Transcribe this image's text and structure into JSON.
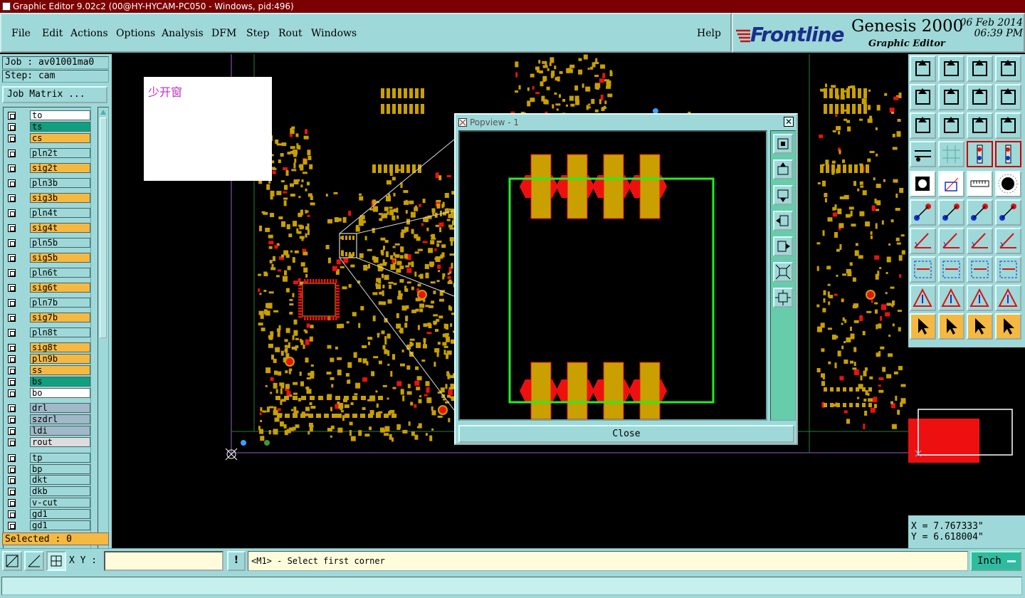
{
  "window": {
    "title": "Graphic Editor 9.02c2 (00@HY-HYCAM-PC050 - Windows, pid:496)"
  },
  "menu": {
    "items": [
      "File",
      "Edit",
      "Actions",
      "Options",
      "Analysis",
      "DFM",
      "Step",
      "Rout",
      "Windows"
    ],
    "help": "Help"
  },
  "brand": {
    "logo": "Frontline",
    "product": "Genesis 2000",
    "subtitle": "Graphic Editor",
    "date": "06 Feb 2014",
    "time": "06:39 PM"
  },
  "job": {
    "job_label": "Job : av01001ma0",
    "step_label": "Step: cam",
    "matrix_button": "Job Matrix ..."
  },
  "layers": [
    {
      "name": "to",
      "color": "#ffffff"
    },
    {
      "name": "ts",
      "color": "#10a080"
    },
    {
      "name": "cs",
      "color": "#f5b942"
    },
    {
      "name": "pln2t",
      "color": "#9fd8d8"
    },
    {
      "name": "sig2t",
      "color": "#f5b942"
    },
    {
      "name": "pln3b",
      "color": "#9fd8d8"
    },
    {
      "name": "sig3b",
      "color": "#f5b942"
    },
    {
      "name": "pln4t",
      "color": "#9fd8d8"
    },
    {
      "name": "sig4t",
      "color": "#f5b942"
    },
    {
      "name": "pln5b",
      "color": "#9fd8d8"
    },
    {
      "name": "sig5b",
      "color": "#f5b942"
    },
    {
      "name": "pln6t",
      "color": "#9fd8d8"
    },
    {
      "name": "sig6t",
      "color": "#f5b942"
    },
    {
      "name": "pln7b",
      "color": "#9fd8d8"
    },
    {
      "name": "sig7b",
      "color": "#f5b942"
    },
    {
      "name": "pln8t",
      "color": "#9fd8d8"
    },
    {
      "name": "sig8t",
      "color": "#f5b942"
    },
    {
      "name": "pln9b",
      "color": "#f5b942"
    },
    {
      "name": "ss",
      "color": "#f5b942"
    },
    {
      "name": "bs",
      "color": "#10a080"
    },
    {
      "name": "bo",
      "color": "#ffffff"
    },
    {
      "name": "drl",
      "color": "#a0b8c8"
    },
    {
      "name": "szdrl",
      "color": "#a0b8c8"
    },
    {
      "name": "ldi",
      "color": "#a0b8c8"
    },
    {
      "name": "rout",
      "color": "#dddddd"
    },
    {
      "name": "tp",
      "color": "#9fd8d8"
    },
    {
      "name": "bp",
      "color": "#9fd8d8"
    },
    {
      "name": "dkt",
      "color": "#9fd8d8"
    },
    {
      "name": "dkb",
      "color": "#9fd8d8"
    },
    {
      "name": "v-cut",
      "color": "#9fd8d8"
    },
    {
      "name": "gd1",
      "color": "#9fd8d8"
    },
    {
      "name": "gd1",
      "color": "#9fd8d8"
    }
  ],
  "selected": "Selected : 0",
  "annotation": "少开窗",
  "popview": {
    "title": "Popview - 1",
    "close_x": "✕",
    "close_button": "Close"
  },
  "coords": {
    "x": "X = 7.767333\"",
    "y": "Y = 6.618004\""
  },
  "bottom": {
    "xy_label": "X Y :",
    "xy_value": "",
    "warn": "!",
    "prompt": "<M1> - Select first corner",
    "units": "Inch"
  },
  "colors": {
    "pad": "#c9a000",
    "pad_red": "#ee1010",
    "outline": "#22ee22",
    "panel": "#9fd8d8"
  }
}
